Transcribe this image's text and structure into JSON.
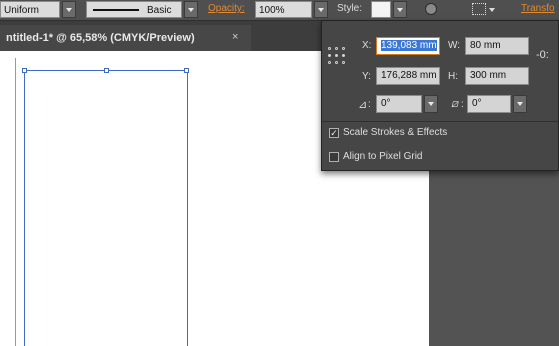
{
  "control_bar": {
    "stroke_profile": "Uniform",
    "brush_label": "Basic",
    "opacity_label": "Opacity:",
    "opacity_value": "100%",
    "style_label": "Style:",
    "transform_label": "Transfo"
  },
  "document_tab": {
    "title": "ntitled-1* @ 65,58% (CMYK/Preview)",
    "close_glyph": "×"
  },
  "transform_panel": {
    "x_label": "X:",
    "x_value": "139,083 mm",
    "y_label": "Y:",
    "y_value": "176,288 mm",
    "w_label": "W:",
    "w_value": "80 mm",
    "h_label": "H:",
    "h_value": "300 mm",
    "rotate_value": "0°",
    "shear_value": "0°",
    "scale_strokes_label": "Scale Strokes & Effects",
    "scale_strokes_checked": true,
    "align_pixel_label": "Align to Pixel Grid",
    "align_pixel_checked": false
  },
  "colors": {
    "selection_blue": "#3f6bc6",
    "accent_orange": "#e08a33",
    "highlight_blue": "#3b77d8"
  }
}
